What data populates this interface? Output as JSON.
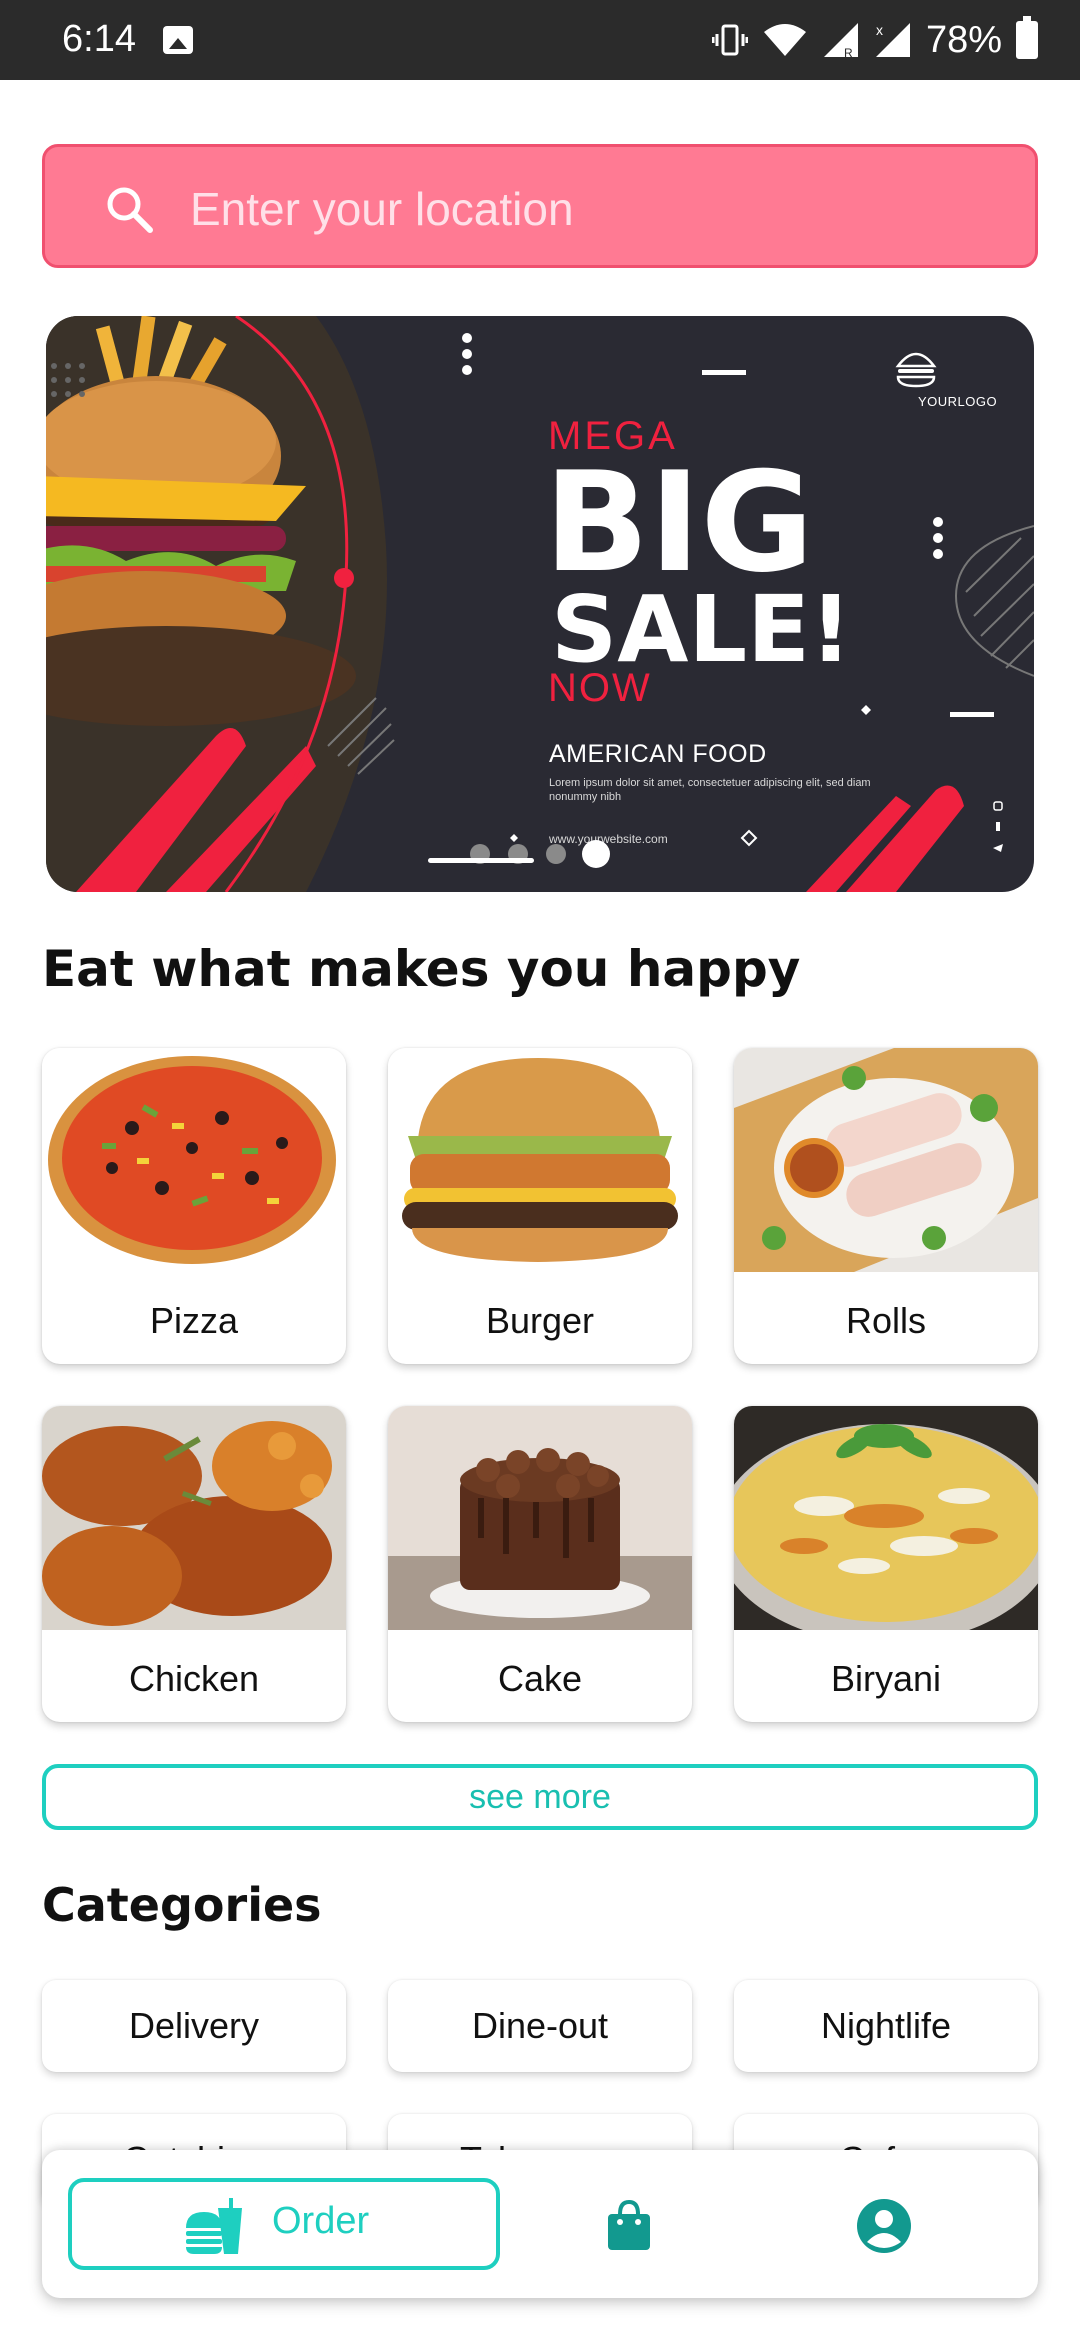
{
  "status_bar": {
    "time": "6:14",
    "battery": "78%",
    "icons": [
      "image-icon",
      "vibrate-icon",
      "wifi-icon",
      "signal-roaming-icon",
      "signal-x-icon",
      "battery-icon"
    ]
  },
  "search": {
    "placeholder": "Enter your location",
    "value": "",
    "icon": "search-icon"
  },
  "banner": {
    "mega": "MEGA",
    "big": "BIG",
    "sale": "SALE!",
    "now": "NOW",
    "subtitle": "AMERICAN FOOD",
    "body": "Lorem ipsum dolor sit amet, consectetuer adipiscing elit, sed diam nonummy nibh",
    "website": "www.yourwebsite.com",
    "logo": "YOURLOGO",
    "slides_total": 4,
    "active_slide": 4,
    "colors": {
      "background": "#2a2a33",
      "accent": "#f0213f"
    }
  },
  "sections": {
    "happy_title": "Eat what makes you happy",
    "categories_title": "Categories"
  },
  "foods": [
    {
      "label": "Pizza",
      "image": "pizza-image"
    },
    {
      "label": "Burger",
      "image": "burger-image"
    },
    {
      "label": "Rolls",
      "image": "rolls-image"
    },
    {
      "label": "Chicken",
      "image": "chicken-image"
    },
    {
      "label": "Cake",
      "image": "cake-image"
    },
    {
      "label": "Biryani",
      "image": "biryani-image"
    }
  ],
  "see_more_label": "see more",
  "categories": [
    {
      "label": "Delivery"
    },
    {
      "label": "Dine-out"
    },
    {
      "label": "Nightlife"
    },
    {
      "label": "Catching"
    },
    {
      "label": "Takeaway"
    },
    {
      "label": "Cafes"
    }
  ],
  "bottom_nav": {
    "order_label": "Order",
    "items": [
      "order-food-icon",
      "shopping-bag-icon",
      "profile-icon"
    ],
    "accent": "#1ecfc0",
    "icon_color": "#12998f"
  }
}
